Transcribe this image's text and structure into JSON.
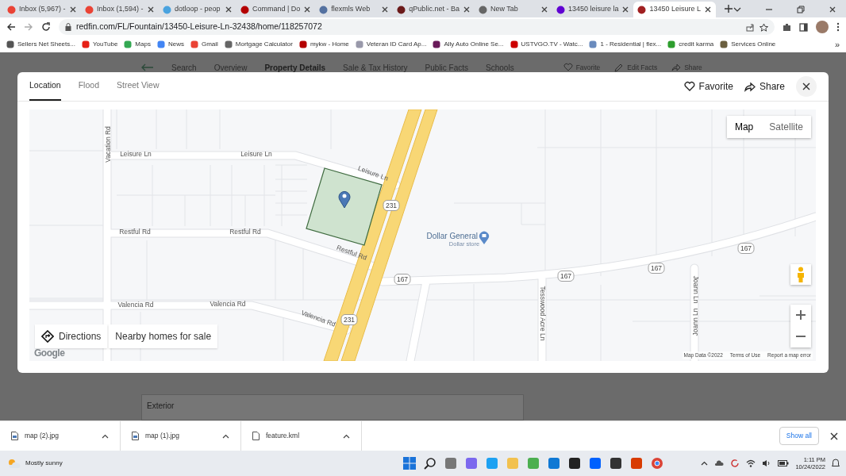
{
  "browser": {
    "tabs": [
      {
        "title": "Inbox (5,967) -",
        "selected": false
      },
      {
        "title": "Inbox (1,594) -",
        "selected": false
      },
      {
        "title": "dotloop - peop",
        "selected": false
      },
      {
        "title": "Command | Do",
        "selected": false
      },
      {
        "title": "flexmls Web",
        "selected": false
      },
      {
        "title": "qPublic.net - Ba",
        "selected": false
      },
      {
        "title": "New Tab",
        "selected": false
      },
      {
        "title": "13450 leisure la",
        "selected": false
      },
      {
        "title": "13450 Leisure L",
        "selected": true
      }
    ],
    "url": "redfin.com/FL/Fountain/13450-Leisure-Ln-32438/home/118257072",
    "bookmarks": [
      "Sellers Net Sheets...",
      "YouTube",
      "Maps",
      "News",
      "Gmail",
      "Mortgage Calculator",
      "mykw - Home",
      "Veteran ID Card Ap...",
      "Ally Auto Online Se...",
      "USTVGO.TV - Watc...",
      "1 - Residential | flex...",
      "credit karma",
      "Services Online"
    ],
    "more_bookmarks": "»"
  },
  "page": {
    "nav": [
      {
        "label": "Search",
        "selected": false
      },
      {
        "label": "Overview",
        "selected": false
      },
      {
        "label": "Property Details",
        "selected": true
      },
      {
        "label": "Sale & Tax History",
        "selected": false
      },
      {
        "label": "Public Facts",
        "selected": false
      },
      {
        "label": "Schools",
        "selected": false
      }
    ],
    "actions": [
      "Favorite",
      "Edit Facts",
      "Share"
    ],
    "section_label": "Exterior"
  },
  "modal": {
    "tabs": [
      {
        "label": "Location",
        "selected": true
      },
      {
        "label": "Flood",
        "selected": false
      },
      {
        "label": "Street View",
        "selected": false
      }
    ],
    "actions": [
      "Favorite",
      "Share"
    ],
    "map": {
      "type_buttons": [
        {
          "label": "Map",
          "selected": true
        },
        {
          "label": "Satellite",
          "selected": false
        }
      ],
      "labels": [
        "Vacation Rd",
        "Leisure Ln",
        "Leisure Ln",
        "Leisure Ln",
        "Restful Rd",
        "Restful Rd",
        "Restful Rd",
        "Valencia Rd",
        "Valencia Rd",
        "Valencia Rd",
        "Tesswood Acre Ln",
        "Joann Ln",
        "Joann Ln"
      ],
      "shields": [
        "231",
        "231",
        "167",
        "167",
        "167",
        "167"
      ],
      "place": {
        "name": "Dollar General",
        "category": "Dollar store"
      },
      "buttons": [
        "Directions",
        "Nearby homes for sale"
      ],
      "logo": "Google",
      "attribution": [
        "Map Data ©2022",
        "Terms of Use",
        "Report a map error"
      ]
    }
  },
  "downloads": {
    "files": [
      "map (2).jpg",
      "map (1).jpg",
      "feature.kml"
    ],
    "show_all": "Show all"
  },
  "taskbar": {
    "weather": "Mostly sunny",
    "time": "1:11 PM",
    "date": "10/24/2022"
  }
}
